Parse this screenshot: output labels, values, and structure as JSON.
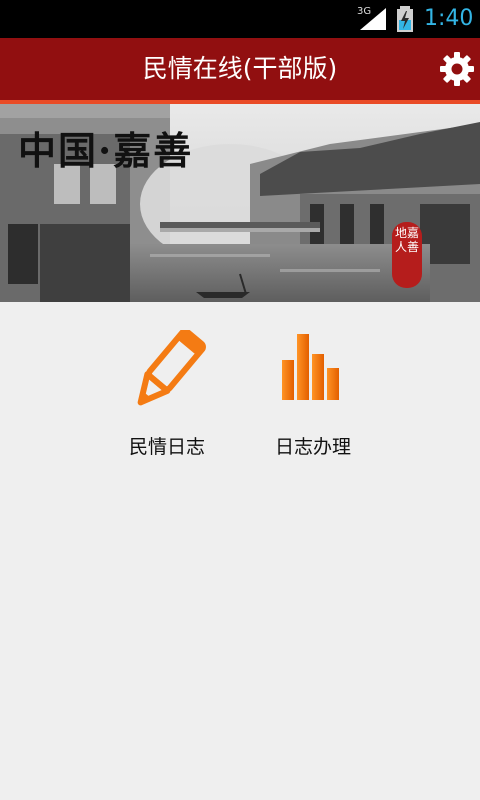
{
  "status_bar": {
    "network": "3G",
    "time": "1:40"
  },
  "header": {
    "title": "民情在线(干部版)",
    "settings_icon": "gear-icon"
  },
  "banner": {
    "headline": "中国·嘉善",
    "seal_text": "地嘉人善"
  },
  "menu": [
    {
      "label": "民情日志",
      "icon": "pencil-icon"
    },
    {
      "label": "日志办理",
      "icon": "bar-chart-icon"
    }
  ],
  "colors": {
    "header_bg": "#910f10",
    "header_underline": "#e94b26",
    "accent_orange": "#f47b13",
    "status_text": "#33b5e5"
  }
}
